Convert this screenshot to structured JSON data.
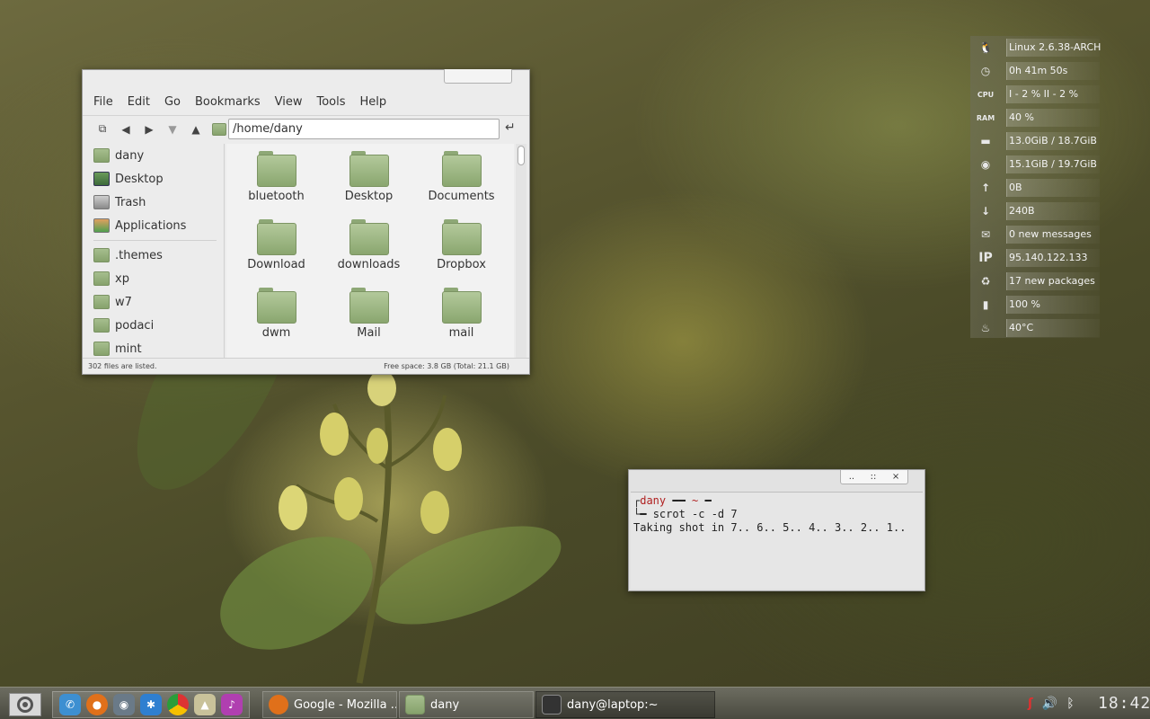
{
  "file_manager": {
    "menu": [
      "File",
      "Edit",
      "Go",
      "Bookmarks",
      "View",
      "Tools",
      "Help"
    ],
    "path": "/home/dany",
    "sidebar_places": [
      "dany",
      "Desktop",
      "Trash",
      "Applications"
    ],
    "sidebar_bookmarks": [
      ".themes",
      "xp",
      "w7",
      "podaci",
      "mint"
    ],
    "items": [
      "bluetooth",
      "Desktop",
      "Documents",
      "Download",
      "downloads",
      "Dropbox",
      "dwm",
      "Mail",
      "mail"
    ],
    "status_left": "302 files are listed.",
    "status_right": "Free space: 3.8 GB (Total: 21.1 GB)"
  },
  "terminal": {
    "controls": [
      "..",
      "::",
      "×"
    ],
    "prompt_user": "dany",
    "prompt_dir": "~",
    "command": "scrot -c -d 7",
    "output": "Taking shot in 7.. 6.. 5.. 4.. 3.. 2.. 1.."
  },
  "conky": [
    {
      "icon": "linux-icon",
      "value": "Linux 2.6.38-ARCH"
    },
    {
      "icon": "clock-icon",
      "value": "0h 41m 50s"
    },
    {
      "icon": "cpu-icon",
      "value": "I - 2 %    II - 2 %"
    },
    {
      "icon": "ram-icon",
      "value": "40 %"
    },
    {
      "icon": "drive-icon",
      "value": "13.0GiB / 18.7GiB"
    },
    {
      "icon": "disk-icon",
      "value": "15.1GiB / 19.7GiB"
    },
    {
      "icon": "upload-icon",
      "value": "0B"
    },
    {
      "icon": "download-icon",
      "value": "240B"
    },
    {
      "icon": "mail-icon",
      "value": "0 new messages"
    },
    {
      "icon": "ip-icon",
      "value": "95.140.122.133"
    },
    {
      "icon": "recycle-icon",
      "value": "17 new packages"
    },
    {
      "icon": "battery-icon",
      "value": "100 %"
    },
    {
      "icon": "temperature-icon",
      "value": "40°C"
    }
  ],
  "conky_labels": {
    "cpu": "CPU",
    "ram": "RAM",
    "ip": "IP"
  },
  "taskbar": {
    "tasks": [
      "Google - Mozilla ...",
      "dany",
      "dany@laptop:~"
    ],
    "clock": "18:42"
  },
  "colors": {
    "accent_folder": "#8aa66f",
    "prompt_red": "#b02020"
  }
}
